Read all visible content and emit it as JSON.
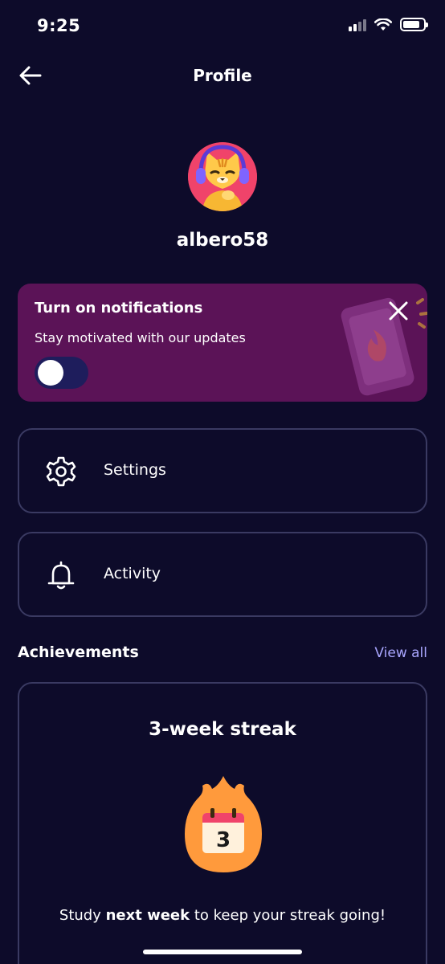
{
  "status_bar": {
    "time": "9:25"
  },
  "header": {
    "title": "Profile"
  },
  "profile": {
    "username": "albero58"
  },
  "notification_card": {
    "title": "Turn on notifications",
    "subtitle": "Stay motivated with our updates",
    "toggle_on": false
  },
  "menu": {
    "settings_label": "Settings",
    "activity_label": "Activity"
  },
  "achievements": {
    "section_title": "Achievements",
    "view_all_label": "View all",
    "card": {
      "title": "3-week streak",
      "badge_number": "3",
      "desc_prefix": "Study ",
      "desc_bold": "next week",
      "desc_suffix": " to keep your streak going!"
    }
  },
  "colors": {
    "background": "#0d0b2a",
    "notification_card": "#5b1357",
    "accent_link": "#a9a6ff",
    "avatar_bg": "#f0436a",
    "flame": "#ff9a3c"
  },
  "icons": [
    "back-arrow-icon",
    "close-icon",
    "gear-icon",
    "bell-icon",
    "flame-calendar-icon",
    "wifi-icon",
    "battery-icon",
    "signal-icon"
  ]
}
